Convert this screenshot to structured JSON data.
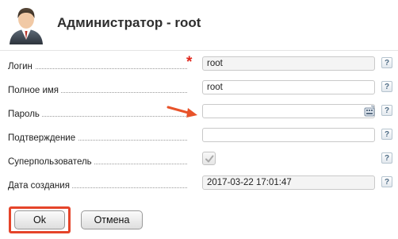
{
  "header": {
    "title": "Администратор - root",
    "avatar_icon": "user-avatar-icon"
  },
  "form": {
    "login": {
      "label": "Логин",
      "value": "root",
      "required_mark": "*"
    },
    "fullname": {
      "label": "Полное имя",
      "value": "root"
    },
    "password": {
      "label": "Пароль",
      "value": "",
      "keyboard_icon": "virtual-keyboard-icon"
    },
    "confirm": {
      "label": "Подтверждение",
      "value": ""
    },
    "superuser": {
      "label": "Суперпользователь",
      "checked": true,
      "disabled": true
    },
    "created": {
      "label": "Дата создания",
      "value": "2017-03-22 17:01:47"
    },
    "help_label": "?"
  },
  "buttons": {
    "ok": "Ok",
    "cancel": "Отмена"
  },
  "colors": {
    "required": "#e0261b",
    "highlight": "#e5442a",
    "arrow": "#e8532a"
  }
}
